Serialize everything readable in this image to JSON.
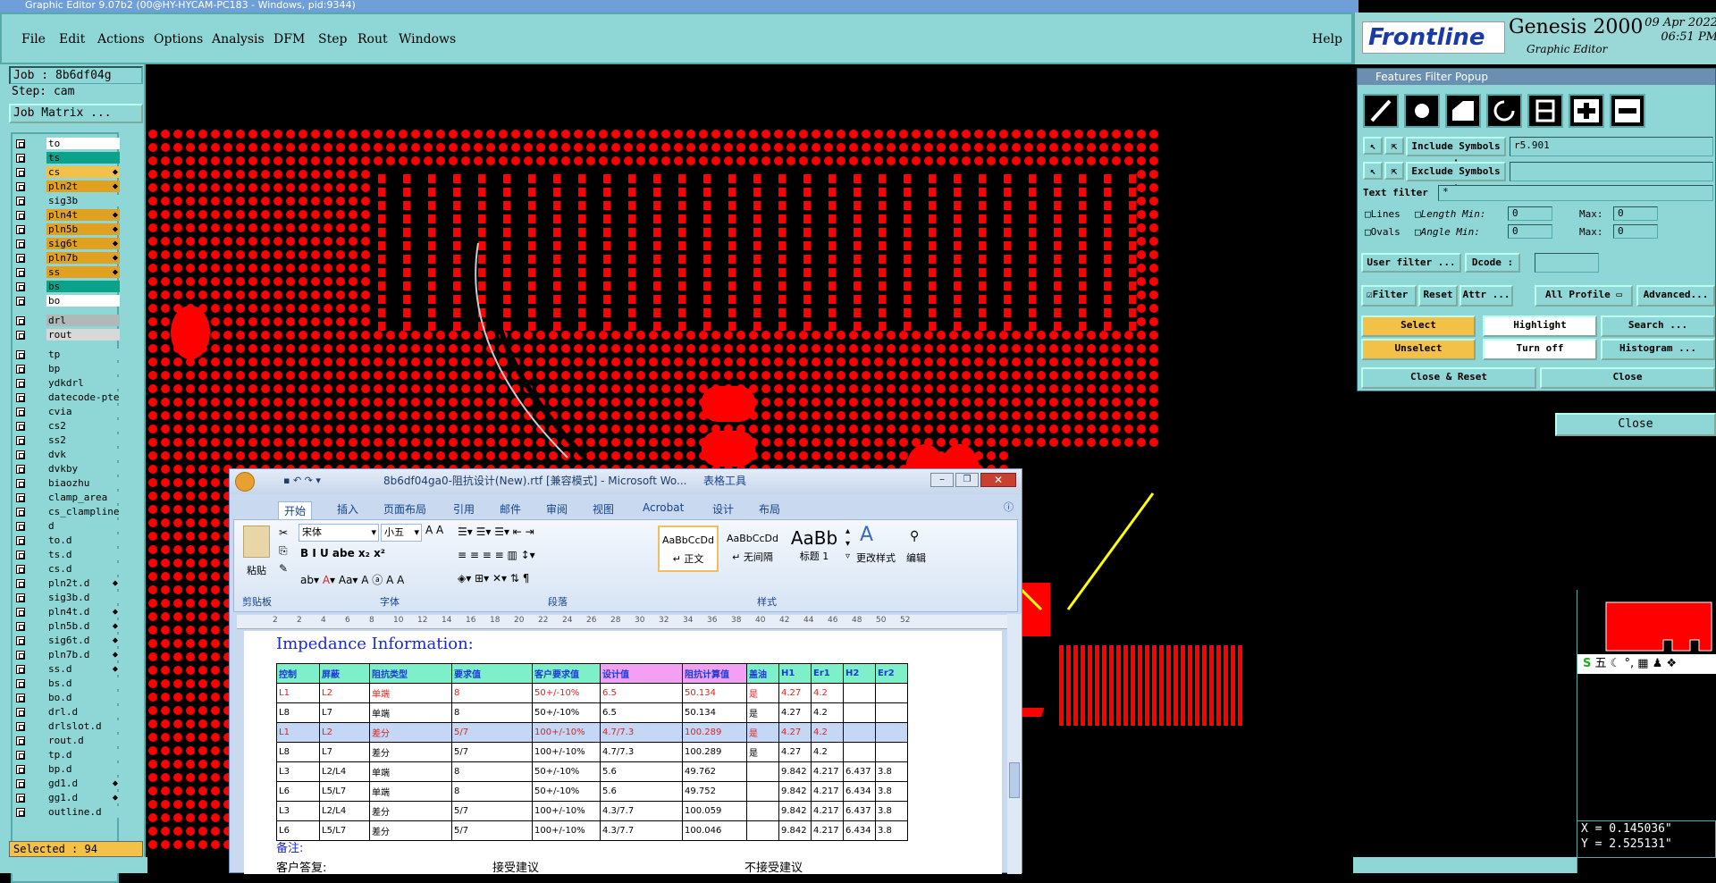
{
  "os_title": "Graphic Editor 9.07b2 (00@HY-HYCAM-PC183 - Windows, pid:9344)",
  "menu": [
    "File",
    "Edit",
    "Actions",
    "Options",
    "Analysis",
    "DFM",
    "Step",
    "Rout",
    "Windows"
  ],
  "help": "Help",
  "brand": {
    "logo": "Frontline",
    "product": "Genesis 2000",
    "subtitle": "Graphic Editor",
    "date": "09 Apr 2022",
    "time": "06:51 PM"
  },
  "job": {
    "job_label": "Job : 8b6df04g",
    "step_label": "Step: cam",
    "matrix_button": "Job Matrix ..."
  },
  "layers": [
    {
      "name": "to",
      "color": "#ffffff"
    },
    {
      "name": "ts",
      "color": "#0aa28a"
    },
    {
      "name": "cs",
      "color": "#f3c048",
      "flag": "⬥"
    },
    {
      "name": "pln2t",
      "color": "#e0a020",
      "flag": "⬥"
    },
    {
      "name": "sig3b",
      "color": "#8fd6d6"
    },
    {
      "name": "pln4t",
      "color": "#e0a020",
      "flag": "⬥"
    },
    {
      "name": "pln5b",
      "color": "#e0a020",
      "flag": "⬥"
    },
    {
      "name": "sig6t",
      "color": "#e0a020",
      "flag": "⬥"
    },
    {
      "name": "pln7b",
      "color": "#e0a020",
      "flag": "⬥"
    },
    {
      "name": "ss",
      "color": "#e0a020",
      "flag": "⬥"
    },
    {
      "name": "bs",
      "color": "#0aa28a"
    },
    {
      "name": "bo",
      "color": "#ffffff"
    },
    {
      "name": "drl",
      "color": "#b0b8b8"
    },
    {
      "name": "rout",
      "color": "#d8d8d8"
    },
    {
      "name": "tp",
      "color": "#8fd6d6"
    },
    {
      "name": "bp",
      "color": "#8fd6d6"
    },
    {
      "name": "ydkdrl",
      "color": "#8fd6d6"
    },
    {
      "name": "datecode-pte",
      "color": "#8fd6d6"
    },
    {
      "name": "cvia",
      "color": "#8fd6d6"
    },
    {
      "name": "cs2",
      "color": "#8fd6d6"
    },
    {
      "name": "ss2",
      "color": "#8fd6d6"
    },
    {
      "name": "dvk",
      "color": "#8fd6d6"
    },
    {
      "name": "dvkby",
      "color": "#8fd6d6"
    },
    {
      "name": "biaozhu",
      "color": "#8fd6d6"
    },
    {
      "name": "clamp_area",
      "color": "#8fd6d6"
    },
    {
      "name": "cs_clampline",
      "color": "#8fd6d6"
    },
    {
      "name": "d",
      "color": "#8fd6d6"
    },
    {
      "name": "to.d",
      "color": "#8fd6d6"
    },
    {
      "name": "ts.d",
      "color": "#8fd6d6"
    },
    {
      "name": "cs.d",
      "color": "#8fd6d6"
    },
    {
      "name": "pln2t.d",
      "color": "#8fd6d6",
      "flag": "⬥"
    },
    {
      "name": "sig3b.d",
      "color": "#8fd6d6"
    },
    {
      "name": "pln4t.d",
      "color": "#8fd6d6",
      "flag": "⬥"
    },
    {
      "name": "pln5b.d",
      "color": "#8fd6d6",
      "flag": "⬥"
    },
    {
      "name": "sig6t.d",
      "color": "#8fd6d6",
      "flag": "⬥"
    },
    {
      "name": "pln7b.d",
      "color": "#8fd6d6",
      "flag": "⬥"
    },
    {
      "name": "ss.d",
      "color": "#8fd6d6",
      "flag": "⬥"
    },
    {
      "name": "bs.d",
      "color": "#8fd6d6"
    },
    {
      "name": "bo.d",
      "color": "#8fd6d6"
    },
    {
      "name": "drl.d",
      "color": "#8fd6d6"
    },
    {
      "name": "drlslot.d",
      "color": "#8fd6d6"
    },
    {
      "name": "rout.d",
      "color": "#8fd6d6"
    },
    {
      "name": "tp.d",
      "color": "#8fd6d6"
    },
    {
      "name": "bp.d",
      "color": "#8fd6d6"
    },
    {
      "name": "gd1.d",
      "color": "#8fd6d6",
      "flag": "⬥"
    },
    {
      "name": "gg1.d",
      "color": "#8fd6d6",
      "flag": "⬥"
    },
    {
      "name": "outline.d",
      "color": "#8fd6d6"
    }
  ],
  "selected": "Selected : 94",
  "filter_popup": {
    "title": "Features Filter Popup",
    "include_label": "Include Symbols :",
    "include_value": "r5.901",
    "exclude_label": "Exclude Symbols :",
    "exclude_value": "",
    "text_filter_label": "Text filter",
    "text_filter_value": "*",
    "lines": "Lines",
    "ovals": "Ovals",
    "length": "Length",
    "angle": "Angle",
    "min": "Min:",
    "max": "Max:",
    "zero": "0",
    "user_filter": "User filter ...",
    "dcode": "Dcode :",
    "filter": "Filter",
    "reset": "Reset",
    "attr": "Attr ...",
    "all_profile": "All Profile",
    "advanced": "Advanced...",
    "select": "Select",
    "highlight": "Highlight",
    "search": "Search ...",
    "unselect": "Unselect",
    "turn_off": "Turn off",
    "histogram": "Histogram ...",
    "close_reset": "Close & Reset",
    "close": "Close"
  },
  "close_big": "Close",
  "ime": "五",
  "coords": {
    "x": "X = 0.145036\"",
    "y": "Y = 2.525131\""
  },
  "word": {
    "title": "8b6df04ga0-阻抗设计(New).rtf [兼容模式] - Microsoft Wo...",
    "tools": "表格工具",
    "tabs": [
      "开始",
      "插入",
      "页面布局",
      "引用",
      "邮件",
      "审阅",
      "视图",
      "Acrobat",
      "设计",
      "布局"
    ],
    "font": "宋体",
    "size": "小五",
    "paste": "粘贴",
    "clipboard": "剪贴板",
    "font_group": "字体",
    "para_group": "段落",
    "style_group": "样式",
    "styles": [
      {
        "preview": "AaBbCcDd",
        "name": "↵ 正文"
      },
      {
        "preview": "AaBbCcDd",
        "name": "↵ 无间隔"
      },
      {
        "preview": "AaBb",
        "name": "标题 1"
      }
    ],
    "change_styles": "更改样式",
    "edit": "编辑",
    "ruler_ticks": [
      "2",
      "2",
      "4",
      "6",
      "8",
      "10",
      "12",
      "14",
      "16",
      "18",
      "20",
      "22",
      "24",
      "26",
      "28",
      "30",
      "32",
      "34",
      "36",
      "38",
      "40",
      "42",
      "44",
      "46",
      "48",
      "50",
      "52"
    ],
    "heading": "Impedance Information:",
    "headers": [
      "控制",
      "屏蔽",
      "阻抗类型",
      "要求值",
      "客户要求值",
      "设计值",
      "阻抗计算值",
      "盖油",
      "H1",
      "Er1",
      "H2",
      "Er2"
    ],
    "rows": [
      {
        "style": "r",
        "cells": [
          "L1",
          "L2",
          "单端",
          "8",
          "50+/-10%",
          "6.5",
          "50.134",
          "是",
          "4.27",
          "4.2",
          "",
          ""
        ]
      },
      {
        "style": "",
        "cells": [
          "L8",
          "L7",
          "单端",
          "8",
          "50+/-10%",
          "6.5",
          "50.134",
          "是",
          "4.27",
          "4.2",
          "",
          ""
        ]
      },
      {
        "style": "sel",
        "cells": [
          "L1",
          "L2",
          "差分",
          "5/7",
          "100+/-10%",
          "4.7/7.3",
          "100.289",
          "是",
          "4.27",
          "4.2",
          "",
          ""
        ]
      },
      {
        "style": "",
        "cells": [
          "L8",
          "L7",
          "差分",
          "5/7",
          "100+/-10%",
          "4.7/7.3",
          "100.289",
          "是",
          "4.27",
          "4.2",
          "",
          ""
        ]
      },
      {
        "style": "",
        "cells": [
          "L3",
          "L2/L4",
          "单端",
          "8",
          "50+/-10%",
          "5.6",
          "49.762",
          "",
          "9.842",
          "4.217",
          "6.437",
          "3.8"
        ]
      },
      {
        "style": "",
        "cells": [
          "L6",
          "L5/L7",
          "单端",
          "8",
          "50+/-10%",
          "5.6",
          "49.752",
          "",
          "9.842",
          "4.217",
          "6.434",
          "3.8"
        ]
      },
      {
        "style": "",
        "cells": [
          "L3",
          "L2/L4",
          "差分",
          "5/7",
          "100+/-10%",
          "4.3/7.7",
          "100.059",
          "",
          "9.842",
          "4.217",
          "6.437",
          "3.8"
        ]
      },
      {
        "style": "",
        "cells": [
          "L6",
          "L5/L7",
          "差分",
          "5/7",
          "100+/-10%",
          "4.3/7.7",
          "100.046",
          "",
          "9.842",
          "4.217",
          "6.434",
          "3.8"
        ]
      }
    ],
    "note": "备注:",
    "reply": "客户答复:",
    "accept": "接受建议",
    "reject": "不接受建议"
  },
  "colors": {
    "pad": "#ff0000",
    "panel": "#8fd6d6",
    "accent": "#f3c048",
    "arrow": "#ffff00"
  }
}
